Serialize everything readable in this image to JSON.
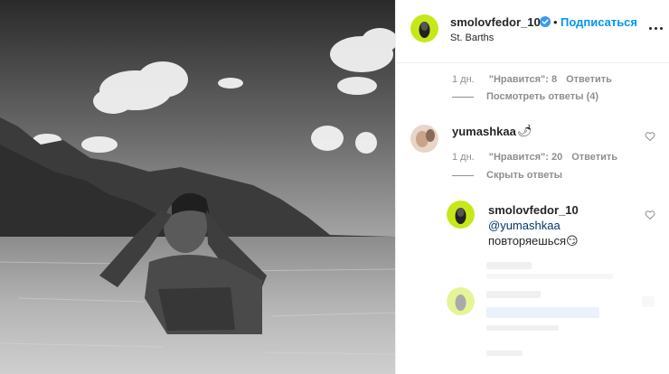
{
  "post": {
    "username": "smolovfedor_10",
    "separator": "•",
    "follow_label": "Подписаться",
    "location": "St. Barths",
    "verified_icon": "verified-badge-icon",
    "more_icon": "more-options-icon"
  },
  "comments": [
    {
      "time": "1 дн.",
      "likes": "\"Нравится\": 8",
      "reply_label": "Ответить",
      "thread_label": "Посмотреть ответы (4)"
    },
    {
      "username": "yumashkaa",
      "emoji": "🌶",
      "time": "1 дн.",
      "likes": "\"Нравится\": 20",
      "reply_label": "Ответить",
      "thread_label": "Скрыть ответы",
      "heart_icon": "heart-outline-icon"
    }
  ],
  "reply": {
    "username": "smolovfedor_10",
    "mention": "@yumashkaa",
    "text": "повторяешься",
    "emoji": "😏",
    "heart_icon": "heart-outline-icon"
  },
  "colors": {
    "link_blue": "#0095f6",
    "mention_blue": "#00376b",
    "muted": "#8e8e8e",
    "text": "#262626",
    "avatar_green": "#c6e81a"
  }
}
